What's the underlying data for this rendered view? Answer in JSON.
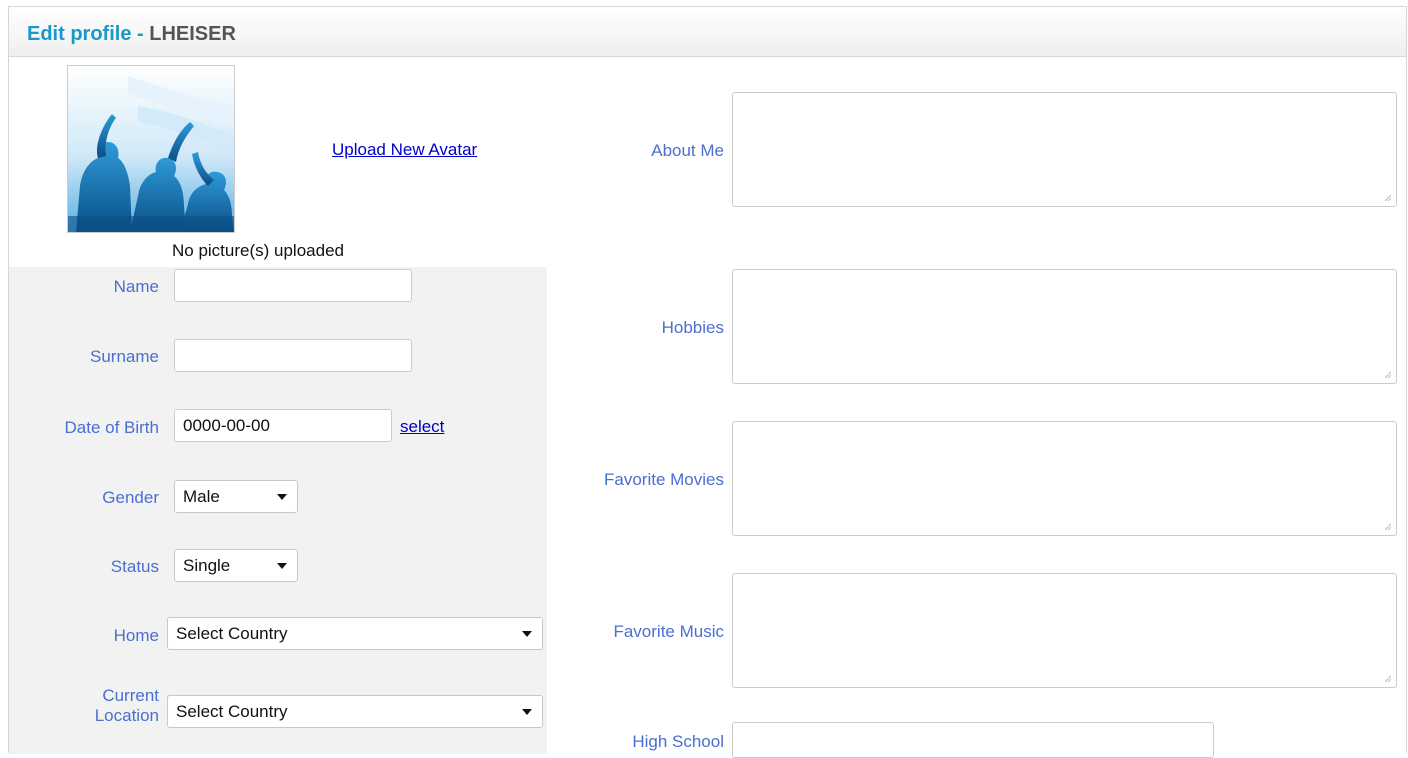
{
  "header": {
    "title_prefix": "Edit profile",
    "title_separator": " - ",
    "username": "LHEISER"
  },
  "avatar": {
    "upload_label": "Upload New Avatar",
    "no_pictures_text": "No picture(s) uploaded"
  },
  "form": {
    "name": {
      "label": "Name",
      "value": ""
    },
    "surname": {
      "label": "Surname",
      "value": ""
    },
    "dob": {
      "label": "Date of Birth",
      "value": "0000-00-00",
      "select_label": "select"
    },
    "gender": {
      "label": "Gender",
      "selected": "Male"
    },
    "status": {
      "label": "Status",
      "selected": "Single"
    },
    "home": {
      "label": "Home",
      "selected": "Select Country"
    },
    "current_location": {
      "label_line1": "Current",
      "label_line2": "Location",
      "selected": "Select Country"
    }
  },
  "right": {
    "about_me": {
      "label": "About Me"
    },
    "hobbies": {
      "label": "Hobbies"
    },
    "favorite_movies": {
      "label": "Favorite Movies"
    },
    "favorite_music": {
      "label": "Favorite Music"
    },
    "high_school": {
      "label": "High School"
    }
  },
  "colors": {
    "title_blue": "#1a99c8",
    "label_blue": "#4b6fd1",
    "link_blue": "#0000cc",
    "panel_gray": "#f2f2f2"
  }
}
